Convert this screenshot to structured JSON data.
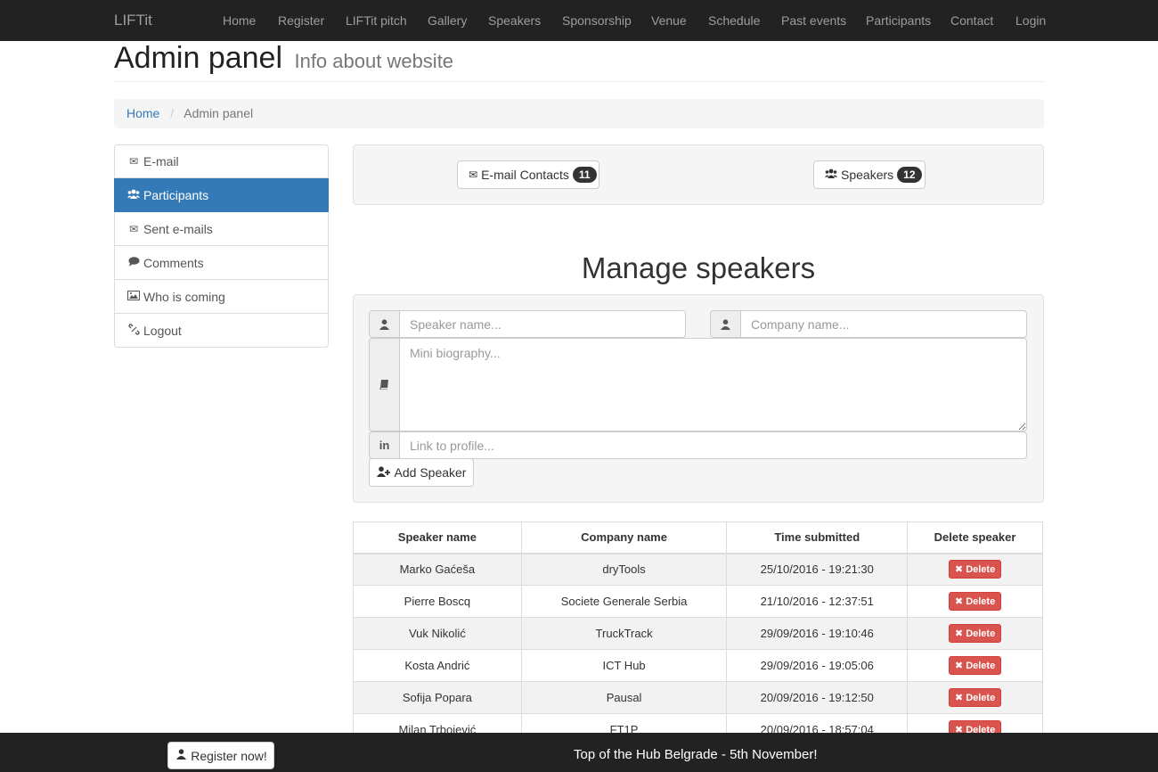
{
  "navbar": {
    "brand": "LIFTit",
    "items": [
      "Home",
      "Register",
      "LIFTit pitch",
      "Gallery",
      "Speakers",
      "Sponsorship",
      "Venue",
      "Schedule",
      "Past events",
      "Participants",
      "Contact",
      "Login"
    ]
  },
  "header": {
    "title": "Admin panel",
    "subtitle": "Info about website"
  },
  "breadcrumb": {
    "home": "Home",
    "separator": "/",
    "current": "Admin panel"
  },
  "sidebar": {
    "items": [
      {
        "label": "E-mail",
        "icon": "envelope-icon"
      },
      {
        "label": "Participants",
        "icon": "users-icon",
        "active": true
      },
      {
        "label": "Sent e-mails",
        "icon": "envelope-icon"
      },
      {
        "label": "Comments",
        "icon": "comment-icon"
      },
      {
        "label": "Who is coming",
        "icon": "picture-icon"
      },
      {
        "label": "Logout",
        "icon": "unlink-icon"
      }
    ]
  },
  "counters": {
    "email_contacts": {
      "label": "E-mail Contacts",
      "count": "11"
    },
    "speakers": {
      "label": "Speakers",
      "count": "12"
    }
  },
  "manage": {
    "title": "Manage speakers",
    "speaker_placeholder": "Speaker name...",
    "company_placeholder": "Company name...",
    "bio_placeholder": "Mini biography...",
    "link_placeholder": "Link to profile...",
    "add_label": "Add Speaker",
    "linkedin_glyph": "in"
  },
  "table": {
    "headers": [
      "Speaker name",
      "Company name",
      "Time submitted",
      "Delete speaker"
    ],
    "delete_label": "Delete",
    "rows": [
      {
        "name": "Marko Gaćeša",
        "company": "dryTools",
        "time": "25/10/2016 - 19:21:30"
      },
      {
        "name": "Pierre Boscq",
        "company": "Societe Generale Serbia",
        "time": "21/10/2016 - 12:37:51"
      },
      {
        "name": "Vuk Nikolić",
        "company": "TruckTrack",
        "time": "29/09/2016 - 19:10:46"
      },
      {
        "name": "Kosta Andrić",
        "company": "ICT Hub",
        "time": "29/09/2016 - 19:05:06"
      },
      {
        "name": "Sofija Popara",
        "company": "Pausal",
        "time": "20/09/2016 - 19:12:50"
      },
      {
        "name": "Milan Trbojević",
        "company": "FT1P",
        "time": "20/09/2016 - 18:57:04"
      }
    ]
  },
  "footer": {
    "register_label": "Register now!",
    "announcement": "Top of the Hub Belgrade - 5th November!"
  },
  "colors": {
    "primary": "#337ab7",
    "danger": "#d9534f",
    "navbar": "#222222"
  }
}
